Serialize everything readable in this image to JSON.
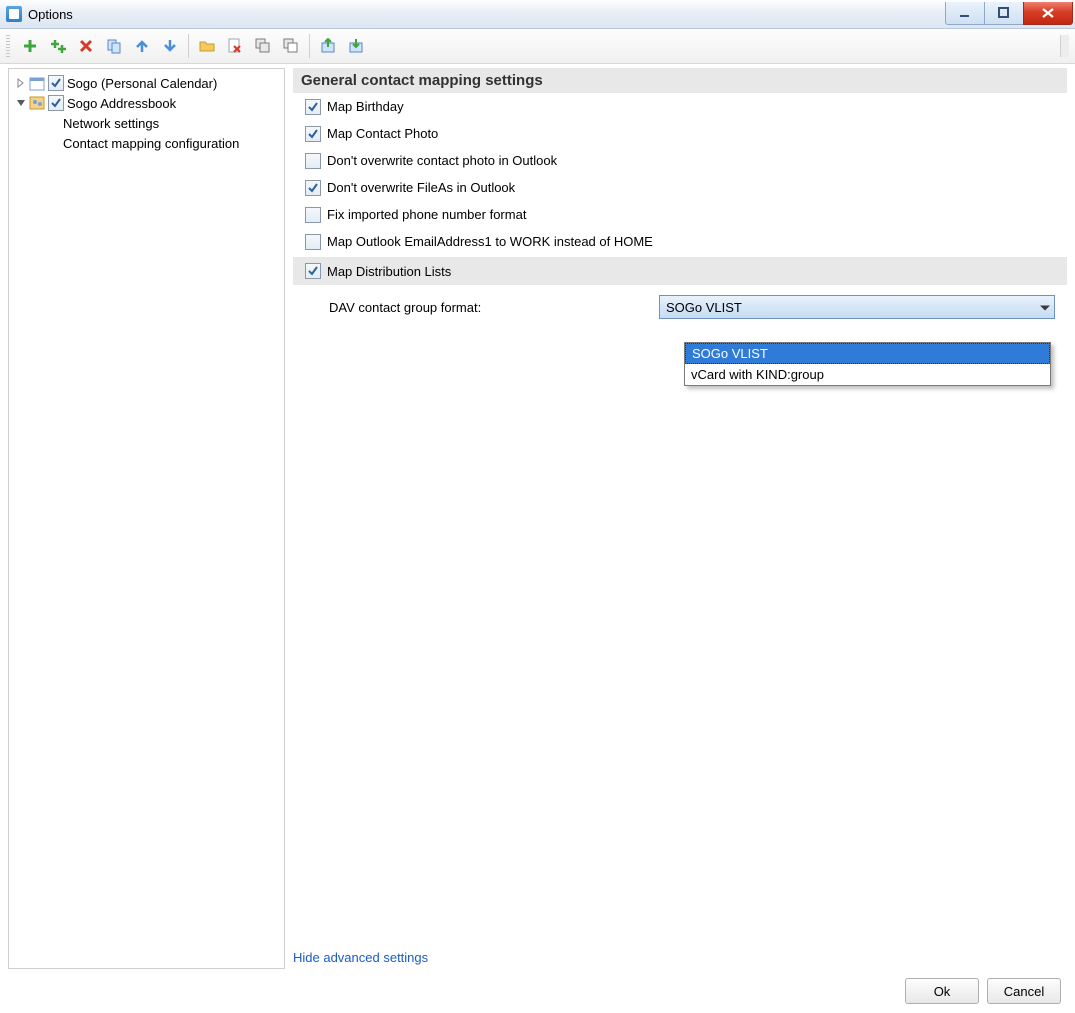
{
  "window": {
    "title": "Options"
  },
  "tree": {
    "items": [
      {
        "label": "Sogo (Personal Calendar)",
        "checked": true,
        "icon": "calendar",
        "expanded": false
      },
      {
        "label": "Sogo Addressbook",
        "checked": true,
        "icon": "contacts",
        "expanded": true,
        "children": [
          {
            "label": "Network settings"
          },
          {
            "label": "Contact mapping configuration",
            "selected": true
          }
        ]
      }
    ]
  },
  "section": {
    "title": "General contact mapping settings"
  },
  "checks": [
    {
      "label": "Map Birthday",
      "checked": true
    },
    {
      "label": "Map Contact Photo",
      "checked": true
    },
    {
      "label": "Don't overwrite contact photo in Outlook",
      "checked": false
    },
    {
      "label": "Don't overwrite FileAs in Outlook",
      "checked": true
    },
    {
      "label": "Fix imported phone number format",
      "checked": false
    },
    {
      "label": "Map Outlook EmailAddress1 to WORK instead of HOME",
      "checked": false
    }
  ],
  "distribution": {
    "label": "Map Distribution Lists",
    "checked": true
  },
  "group_format": {
    "label": "DAV contact group format:",
    "selected": "SOGo VLIST",
    "options": [
      "SOGo VLIST",
      "vCard with KIND:group"
    ]
  },
  "advanced_link": "Hide advanced settings",
  "buttons": {
    "ok": "Ok",
    "cancel": "Cancel"
  }
}
